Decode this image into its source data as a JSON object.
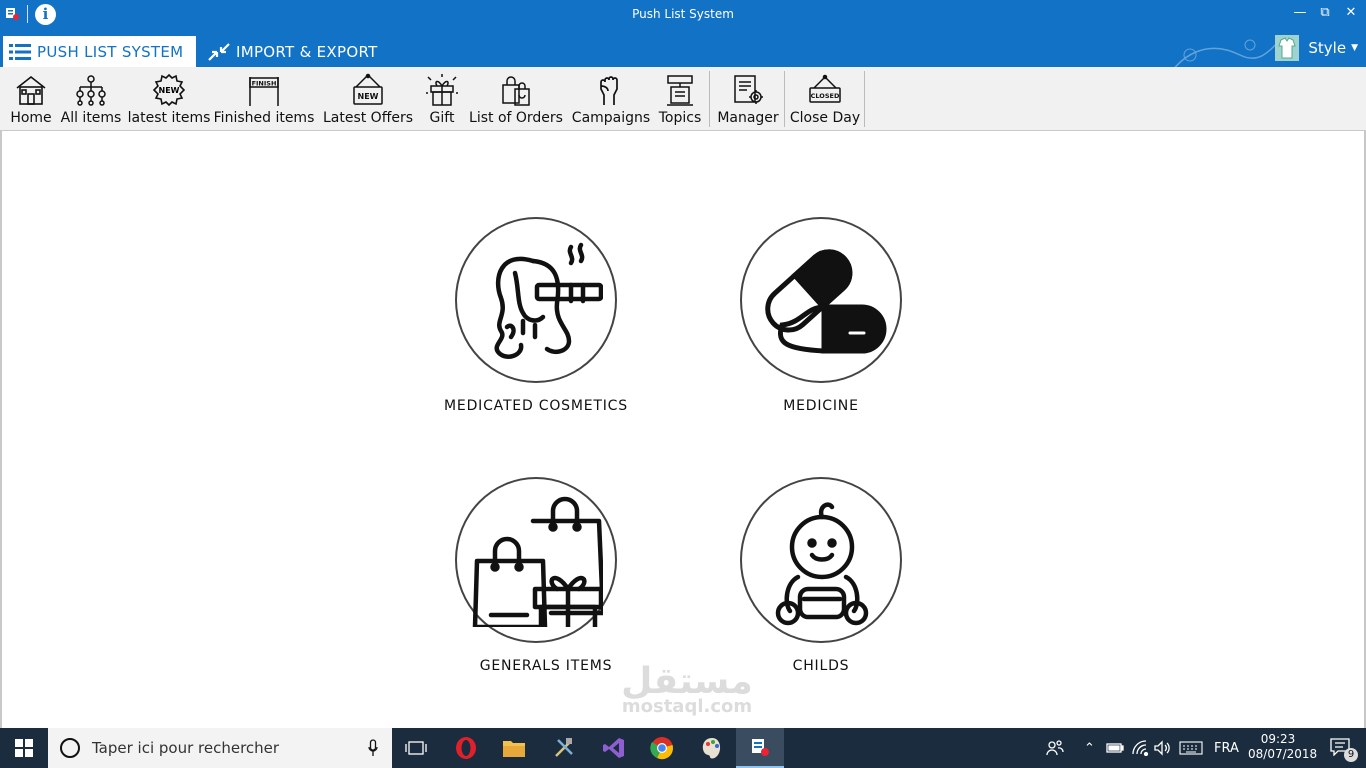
{
  "window": {
    "title": "Push List System"
  },
  "tabs": [
    {
      "label": "PUSH LIST SYSTEM",
      "icon": "list-icon"
    },
    {
      "label": "IMPORT & EXPORT",
      "icon": "import-export-icon"
    }
  ],
  "style_menu": {
    "label": "Style"
  },
  "toolbar": {
    "home": "Home",
    "all_items": "All items",
    "latest_items": "latest items",
    "finished_items": "Finished items",
    "latest_offers": "Latest Offers",
    "gift": "Gift",
    "list_of_orders": "List of Orders",
    "campaigns": "Campaigns",
    "topics": "Topics",
    "manager": "Manager",
    "close_day": "Close Day"
  },
  "icon_text": {
    "new": "NEW",
    "finish": "FINISH",
    "closed": "CLOSED"
  },
  "categories": [
    {
      "label": "MEDICATED COSMETICS",
      "icon": "cosmetics-woman-icon"
    },
    {
      "label": "MEDICINE",
      "icon": "capsule-icon"
    },
    {
      "label": "GENERALS ITEMS",
      "icon": "shopping-bags-icon"
    },
    {
      "label": "CHILDS",
      "icon": "baby-icon"
    }
  ],
  "watermark": {
    "text": "مستقل",
    "sub": "mostaql.com"
  },
  "taskbar": {
    "search_placeholder": "Taper ici pour rechercher",
    "language": "FRA",
    "time": "09:23",
    "date": "08/07/2018",
    "notification_count": "9"
  },
  "colors": {
    "accent": "#1172c6",
    "taskbar": "#1a2c3d",
    "toolbar_bg": "#f1f1f1"
  }
}
